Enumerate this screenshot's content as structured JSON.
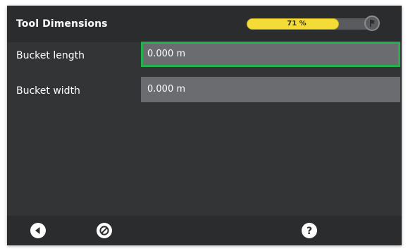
{
  "header": {
    "title": "Tool Dimensions",
    "progress_text": "71 %",
    "progress_value": 0.71,
    "flag_icon": "flag-icon"
  },
  "fields": [
    {
      "label": "Bucket length",
      "value": "0.000 m",
      "focused": true
    },
    {
      "label": "Bucket width",
      "value": "0.000 m",
      "focused": false
    }
  ],
  "footer": {
    "back_icon": "back-arrow-icon",
    "cancel_icon": "cancel-icon",
    "help_icon": "help-icon"
  },
  "colors": {
    "background": "#333436",
    "field": "#6b6c70",
    "focus_border": "#22b14c",
    "progress_fill": "#f3dc38"
  }
}
